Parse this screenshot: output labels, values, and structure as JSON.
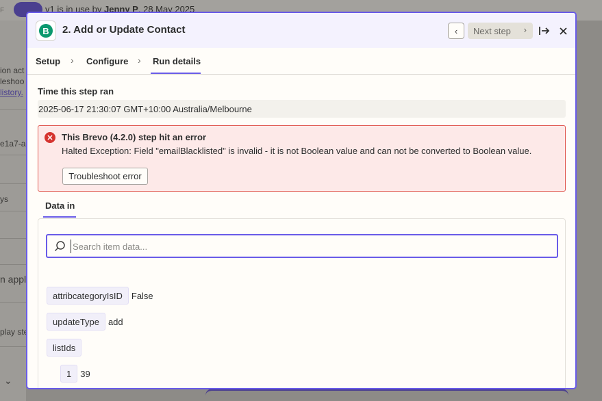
{
  "background": {
    "toggle_letter": "F",
    "version_text": "v1  is in use by",
    "version_user": "Jenny P",
    "version_date": "28 May 2025",
    "left_fragments": [
      "ion act",
      "leshoo",
      "listory.",
      "e1a7-a",
      "ys",
      "n appl",
      "play ste"
    ]
  },
  "modal": {
    "title": "2. Add or Update Contact",
    "app_logo_letter": "B",
    "app_color": "#0b996e",
    "accent_color": "#695be8",
    "nav": {
      "prev_icon": "chevron-left-icon",
      "next_label": "Next step",
      "next_icon": "chevron-right-icon",
      "expand_icon": "expand-icon",
      "close_icon": "close-icon"
    },
    "tabs": [
      {
        "label": "Setup"
      },
      {
        "label": "Configure"
      },
      {
        "label": "Run details",
        "active": true
      }
    ],
    "time_label": "Time this step ran",
    "time_value": "2025-06-17 21:30:07 GMT+10:00 Australia/Melbourne",
    "error": {
      "title": "This Brevo (4.2.0) step hit an error",
      "message": "Halted Exception: Field \"emailBlacklisted\" is invalid - it is not Boolean value and can not be converted to Boolean value.",
      "button_label": "Troubleshoot error",
      "color": "#d5342f"
    },
    "data_tab_label": "Data in",
    "search_placeholder": "Search item data...",
    "data_items": [
      {
        "key": "attribcategoryIsID",
        "value": "False"
      },
      {
        "key": "updateType",
        "value": "add"
      },
      {
        "key": "listIds",
        "value": ""
      },
      {
        "key": "1",
        "value": "39"
      }
    ]
  }
}
